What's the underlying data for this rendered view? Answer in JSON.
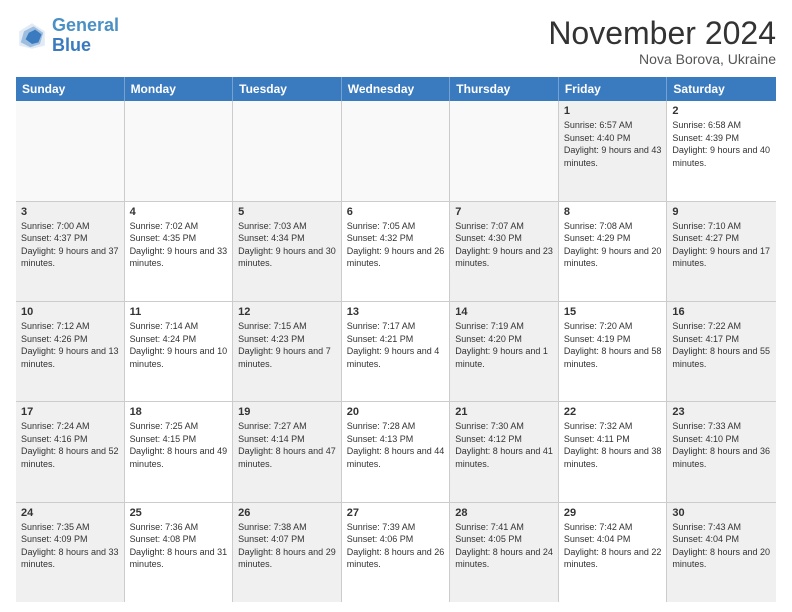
{
  "header": {
    "logo_line1": "General",
    "logo_line2": "Blue",
    "month_title": "November 2024",
    "location": "Nova Borova, Ukraine"
  },
  "days_of_week": [
    "Sunday",
    "Monday",
    "Tuesday",
    "Wednesday",
    "Thursday",
    "Friday",
    "Saturday"
  ],
  "rows": [
    [
      {
        "day": "",
        "text": "",
        "empty": true
      },
      {
        "day": "",
        "text": "",
        "empty": true
      },
      {
        "day": "",
        "text": "",
        "empty": true
      },
      {
        "day": "",
        "text": "",
        "empty": true
      },
      {
        "day": "",
        "text": "",
        "empty": true
      },
      {
        "day": "1",
        "text": "Sunrise: 6:57 AM\nSunset: 4:40 PM\nDaylight: 9 hours and 43 minutes.",
        "shaded": true
      },
      {
        "day": "2",
        "text": "Sunrise: 6:58 AM\nSunset: 4:39 PM\nDaylight: 9 hours and 40 minutes.",
        "shaded": false
      }
    ],
    [
      {
        "day": "3",
        "text": "Sunrise: 7:00 AM\nSunset: 4:37 PM\nDaylight: 9 hours and 37 minutes.",
        "shaded": true
      },
      {
        "day": "4",
        "text": "Sunrise: 7:02 AM\nSunset: 4:35 PM\nDaylight: 9 hours and 33 minutes.",
        "shaded": false
      },
      {
        "day": "5",
        "text": "Sunrise: 7:03 AM\nSunset: 4:34 PM\nDaylight: 9 hours and 30 minutes.",
        "shaded": true
      },
      {
        "day": "6",
        "text": "Sunrise: 7:05 AM\nSunset: 4:32 PM\nDaylight: 9 hours and 26 minutes.",
        "shaded": false
      },
      {
        "day": "7",
        "text": "Sunrise: 7:07 AM\nSunset: 4:30 PM\nDaylight: 9 hours and 23 minutes.",
        "shaded": true
      },
      {
        "day": "8",
        "text": "Sunrise: 7:08 AM\nSunset: 4:29 PM\nDaylight: 9 hours and 20 minutes.",
        "shaded": false
      },
      {
        "day": "9",
        "text": "Sunrise: 7:10 AM\nSunset: 4:27 PM\nDaylight: 9 hours and 17 minutes.",
        "shaded": true
      }
    ],
    [
      {
        "day": "10",
        "text": "Sunrise: 7:12 AM\nSunset: 4:26 PM\nDaylight: 9 hours and 13 minutes.",
        "shaded": true
      },
      {
        "day": "11",
        "text": "Sunrise: 7:14 AM\nSunset: 4:24 PM\nDaylight: 9 hours and 10 minutes.",
        "shaded": false
      },
      {
        "day": "12",
        "text": "Sunrise: 7:15 AM\nSunset: 4:23 PM\nDaylight: 9 hours and 7 minutes.",
        "shaded": true
      },
      {
        "day": "13",
        "text": "Sunrise: 7:17 AM\nSunset: 4:21 PM\nDaylight: 9 hours and 4 minutes.",
        "shaded": false
      },
      {
        "day": "14",
        "text": "Sunrise: 7:19 AM\nSunset: 4:20 PM\nDaylight: 9 hours and 1 minute.",
        "shaded": true
      },
      {
        "day": "15",
        "text": "Sunrise: 7:20 AM\nSunset: 4:19 PM\nDaylight: 8 hours and 58 minutes.",
        "shaded": false
      },
      {
        "day": "16",
        "text": "Sunrise: 7:22 AM\nSunset: 4:17 PM\nDaylight: 8 hours and 55 minutes.",
        "shaded": true
      }
    ],
    [
      {
        "day": "17",
        "text": "Sunrise: 7:24 AM\nSunset: 4:16 PM\nDaylight: 8 hours and 52 minutes.",
        "shaded": true
      },
      {
        "day": "18",
        "text": "Sunrise: 7:25 AM\nSunset: 4:15 PM\nDaylight: 8 hours and 49 minutes.",
        "shaded": false
      },
      {
        "day": "19",
        "text": "Sunrise: 7:27 AM\nSunset: 4:14 PM\nDaylight: 8 hours and 47 minutes.",
        "shaded": true
      },
      {
        "day": "20",
        "text": "Sunrise: 7:28 AM\nSunset: 4:13 PM\nDaylight: 8 hours and 44 minutes.",
        "shaded": false
      },
      {
        "day": "21",
        "text": "Sunrise: 7:30 AM\nSunset: 4:12 PM\nDaylight: 8 hours and 41 minutes.",
        "shaded": true
      },
      {
        "day": "22",
        "text": "Sunrise: 7:32 AM\nSunset: 4:11 PM\nDaylight: 8 hours and 38 minutes.",
        "shaded": false
      },
      {
        "day": "23",
        "text": "Sunrise: 7:33 AM\nSunset: 4:10 PM\nDaylight: 8 hours and 36 minutes.",
        "shaded": true
      }
    ],
    [
      {
        "day": "24",
        "text": "Sunrise: 7:35 AM\nSunset: 4:09 PM\nDaylight: 8 hours and 33 minutes.",
        "shaded": true
      },
      {
        "day": "25",
        "text": "Sunrise: 7:36 AM\nSunset: 4:08 PM\nDaylight: 8 hours and 31 minutes.",
        "shaded": false
      },
      {
        "day": "26",
        "text": "Sunrise: 7:38 AM\nSunset: 4:07 PM\nDaylight: 8 hours and 29 minutes.",
        "shaded": true
      },
      {
        "day": "27",
        "text": "Sunrise: 7:39 AM\nSunset: 4:06 PM\nDaylight: 8 hours and 26 minutes.",
        "shaded": false
      },
      {
        "day": "28",
        "text": "Sunrise: 7:41 AM\nSunset: 4:05 PM\nDaylight: 8 hours and 24 minutes.",
        "shaded": true
      },
      {
        "day": "29",
        "text": "Sunrise: 7:42 AM\nSunset: 4:04 PM\nDaylight: 8 hours and 22 minutes.",
        "shaded": false
      },
      {
        "day": "30",
        "text": "Sunrise: 7:43 AM\nSunset: 4:04 PM\nDaylight: 8 hours and 20 minutes.",
        "shaded": true
      }
    ]
  ]
}
